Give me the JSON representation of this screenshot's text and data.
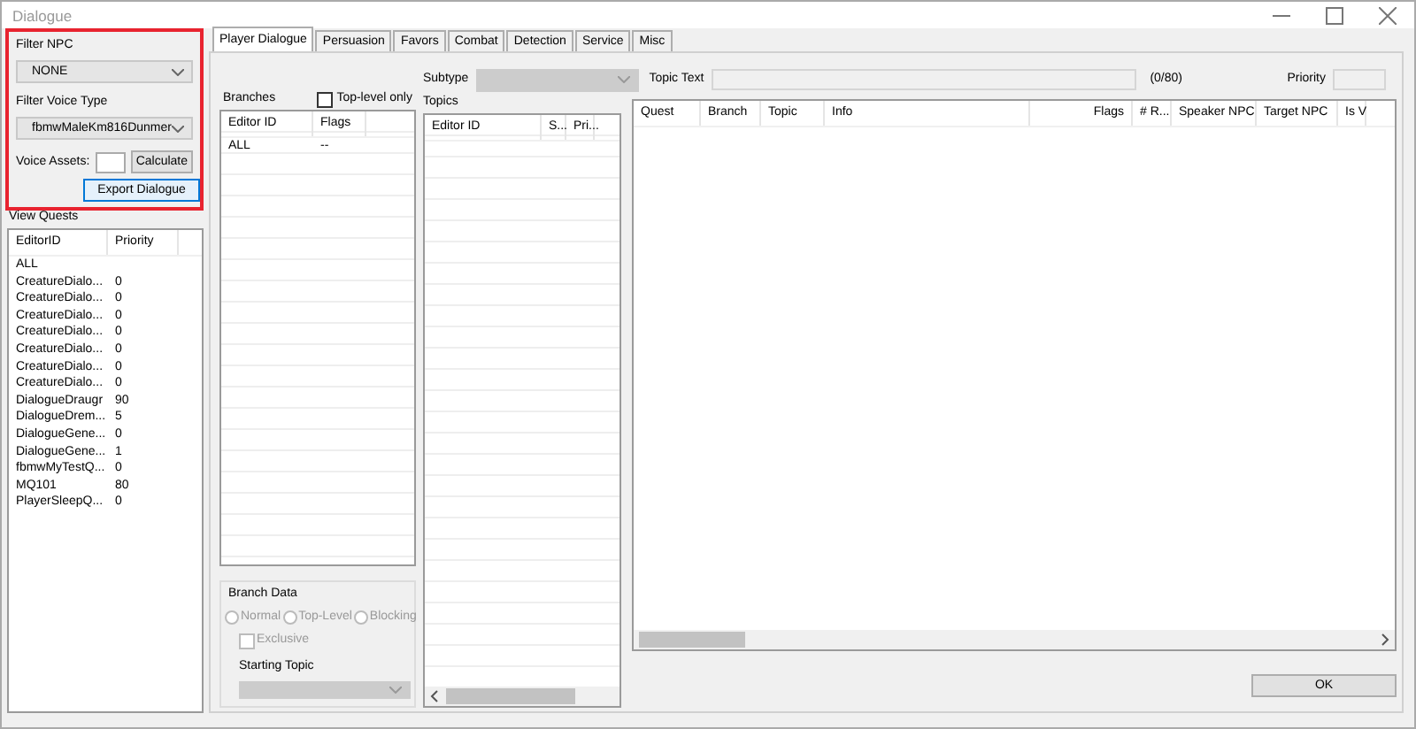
{
  "window": {
    "title": "Dialogue"
  },
  "filter_panel": {
    "highlighted": true,
    "npc_label": "Filter NPC",
    "npc_value": "NONE",
    "voice_label": "Filter Voice Type",
    "voice_value": "fbmwMaleKm816Dunmer",
    "assets_label": "Voice Assets:",
    "calculate_button": "Calculate",
    "export_button": "Export Dialogue"
  },
  "quests": {
    "label": "View Quests",
    "columns": [
      "EditorID",
      "Priority"
    ],
    "rows": [
      {
        "editor_id": "ALL",
        "priority": ""
      },
      {
        "editor_id": "CreatureDialo...",
        "priority": "0"
      },
      {
        "editor_id": "CreatureDialo...",
        "priority": "0"
      },
      {
        "editor_id": "CreatureDialo...",
        "priority": "0"
      },
      {
        "editor_id": "CreatureDialo...",
        "priority": "0"
      },
      {
        "editor_id": "CreatureDialo...",
        "priority": "0"
      },
      {
        "editor_id": "CreatureDialo...",
        "priority": "0"
      },
      {
        "editor_id": "CreatureDialo...",
        "priority": "0"
      },
      {
        "editor_id": "DialogueDraugr",
        "priority": "90"
      },
      {
        "editor_id": "DialogueDrem...",
        "priority": "5"
      },
      {
        "editor_id": "DialogueGene...",
        "priority": "0"
      },
      {
        "editor_id": "DialogueGene...",
        "priority": "1"
      },
      {
        "editor_id": "fbmwMyTestQ...",
        "priority": "0"
      },
      {
        "editor_id": "MQ101",
        "priority": "80"
      },
      {
        "editor_id": "PlayerSleepQ...",
        "priority": "0"
      }
    ]
  },
  "tabs": [
    {
      "label": "Player Dialogue",
      "selected": true
    },
    {
      "label": "Persuasion",
      "selected": false
    },
    {
      "label": "Favors",
      "selected": false
    },
    {
      "label": "Combat",
      "selected": false
    },
    {
      "label": "Detection",
      "selected": false
    },
    {
      "label": "Service",
      "selected": false
    },
    {
      "label": "Misc",
      "selected": false
    }
  ],
  "branches": {
    "label": "Branches",
    "top_level_only": {
      "label": "Top-level only",
      "checked": false
    },
    "columns": [
      "Editor ID",
      "Flags"
    ],
    "rows": [
      {
        "editor_id": "ALL",
        "flags": "--"
      }
    ]
  },
  "subtype": {
    "label": "Subtype",
    "disabled": true
  },
  "topic_text": {
    "label": "Topic Text",
    "counter": "(0/80)"
  },
  "priority": {
    "label": "Priority"
  },
  "topics": {
    "label": "Topics",
    "columns": [
      "Editor ID",
      "S...",
      "Pri..."
    ]
  },
  "infos": {
    "columns": [
      "Quest",
      "Branch",
      "Topic",
      "Info",
      "Flags",
      "# R...",
      "Speaker NPC",
      "Target NPC",
      "Is V"
    ]
  },
  "branch_data": {
    "title": "Branch Data",
    "disabled": true,
    "radios": [
      {
        "label": "Normal",
        "selected": false
      },
      {
        "label": "Top-Level",
        "selected": false
      },
      {
        "label": "Blocking",
        "selected": false
      }
    ],
    "exclusive": {
      "label": "Exclusive",
      "checked": false
    },
    "starting_topic_label": "Starting Topic"
  },
  "ok_button": "OK"
}
